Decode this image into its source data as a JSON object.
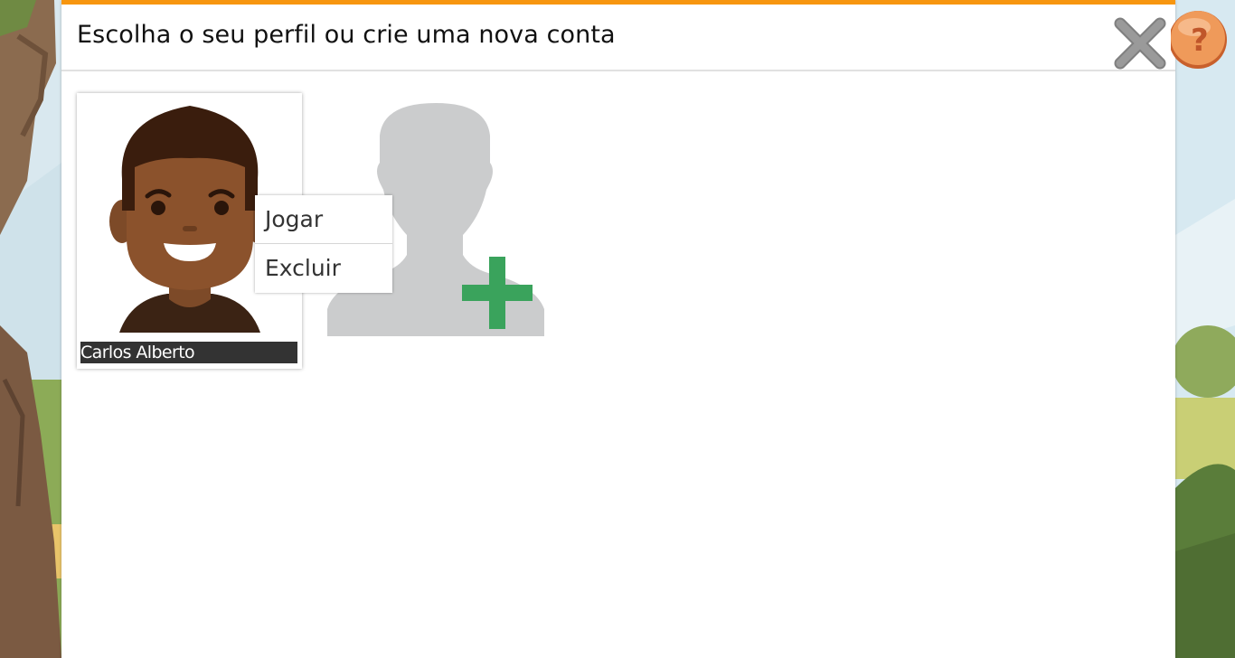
{
  "dialog": {
    "title": "Escolha o seu perfil ou crie uma nova conta",
    "close_icon": "close-x-icon",
    "help_icon": "question-mark-icon",
    "accent_color": "#f7960f"
  },
  "profiles": [
    {
      "name": "Carlos Alberto",
      "avatar": "boy-avatar"
    }
  ],
  "new_account": {
    "icon": "add-user-silhouette-icon",
    "plus_color": "#3aa35c"
  },
  "context_menu": {
    "items": [
      {
        "label": "Jogar"
      },
      {
        "label": "Excluir"
      }
    ]
  }
}
